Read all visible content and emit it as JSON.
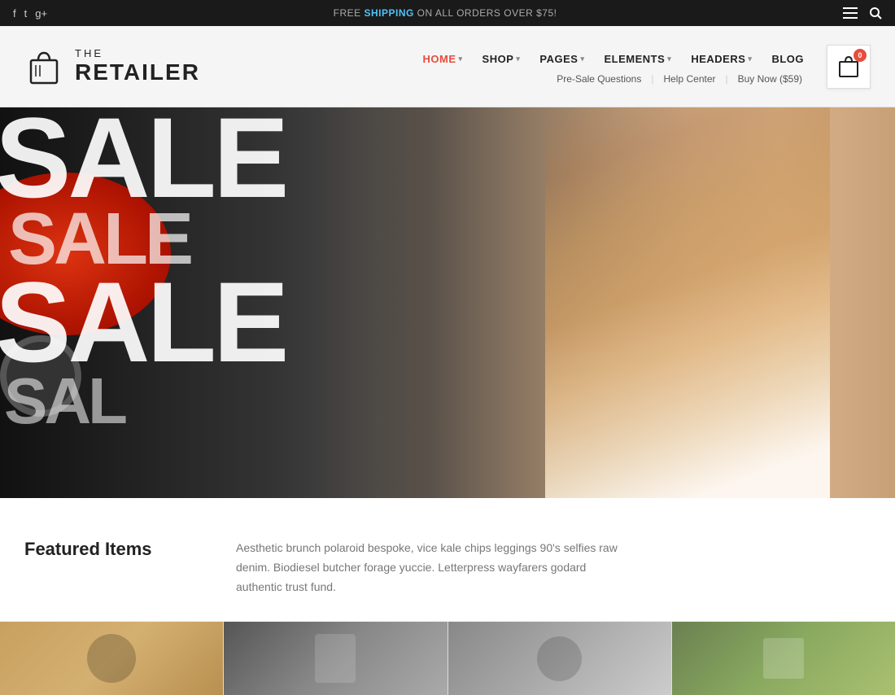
{
  "topbar": {
    "shipping_text": "FREE ",
    "shipping_highlight": "SHIPPING",
    "shipping_rest": " ON ALL ORDERS OVER $75!",
    "social": {
      "facebook": "f",
      "twitter": "t",
      "googleplus": "g+"
    }
  },
  "header": {
    "logo": {
      "the": "THE",
      "retailer": "RETAILER"
    },
    "nav": {
      "items": [
        {
          "label": "HOME",
          "has_dropdown": true,
          "active": true
        },
        {
          "label": "SHOP",
          "has_dropdown": true,
          "active": false
        },
        {
          "label": "PAGES",
          "has_dropdown": true,
          "active": false
        },
        {
          "label": "ELEMENTS",
          "has_dropdown": true,
          "active": false
        },
        {
          "label": "HEADERS",
          "has_dropdown": true,
          "active": false
        },
        {
          "label": "BLOG",
          "has_dropdown": false,
          "active": false
        }
      ],
      "secondary": [
        {
          "label": "Pre-Sale Questions"
        },
        {
          "label": "Help Center"
        },
        {
          "label": "Buy Now ($59)"
        }
      ]
    },
    "cart": {
      "badge": "0"
    }
  },
  "hero": {
    "sale_lines": [
      "SALE",
      "SALE",
      "SALE",
      "SAL"
    ]
  },
  "featured": {
    "title": "Featured Items",
    "description": "Aesthetic brunch polaroid bespoke, vice kale chips leggings 90's selfies raw denim. Biodiesel butcher forage yuccie. Letterpress wayfarers godard authentic trust fund."
  },
  "products": [
    {
      "id": 1
    },
    {
      "id": 2
    },
    {
      "id": 3
    },
    {
      "id": 4
    }
  ]
}
